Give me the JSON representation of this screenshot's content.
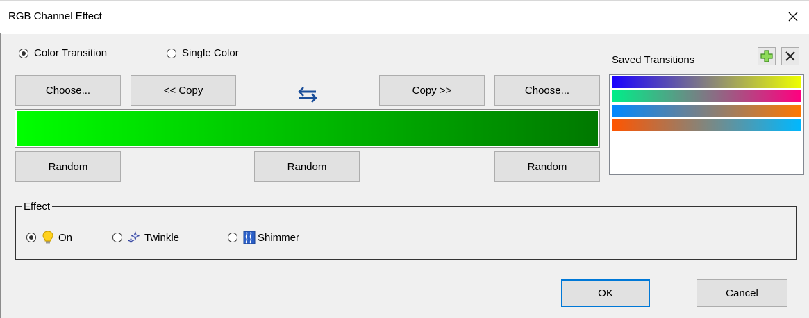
{
  "window": {
    "title": "RGB Channel Effect"
  },
  "mode": {
    "color_transition_label": "Color Transition",
    "single_color_label": "Single Color",
    "selected": "color_transition"
  },
  "buttons": {
    "choose_left": "Choose...",
    "copy_left": "<< Copy",
    "copy_right": "Copy >>",
    "choose_right": "Choose...",
    "random_left": "Random",
    "random_middle": "Random",
    "random_right": "Random",
    "ok": "OK",
    "cancel": "Cancel"
  },
  "gradient": {
    "start_color": "#00ff00",
    "end_color": "#007800"
  },
  "saved_transitions": {
    "label": "Saved Transitions",
    "add_icon": "plus-icon",
    "delete_icon": "x-icon",
    "items": [
      {
        "from": "#1a00ff",
        "to": "#eeff00"
      },
      {
        "from": "#00ee88",
        "to": "#ff0080"
      },
      {
        "from": "#0088ff",
        "to": "#ff7700"
      },
      {
        "from": "#ff5500",
        "to": "#00b8ff"
      }
    ]
  },
  "effect": {
    "group_label": "Effect",
    "options": [
      {
        "label": "On",
        "icon": "lightbulb-icon",
        "selected": true
      },
      {
        "label": "Twinkle",
        "icon": "sparkle-icon",
        "selected": false
      },
      {
        "label": "Shimmer",
        "icon": "shimmer-icon",
        "selected": false
      }
    ]
  },
  "colors": {
    "accent": "#0078d7",
    "button_bg": "#e1e1e1",
    "window_bg": "#f0f0f0"
  }
}
